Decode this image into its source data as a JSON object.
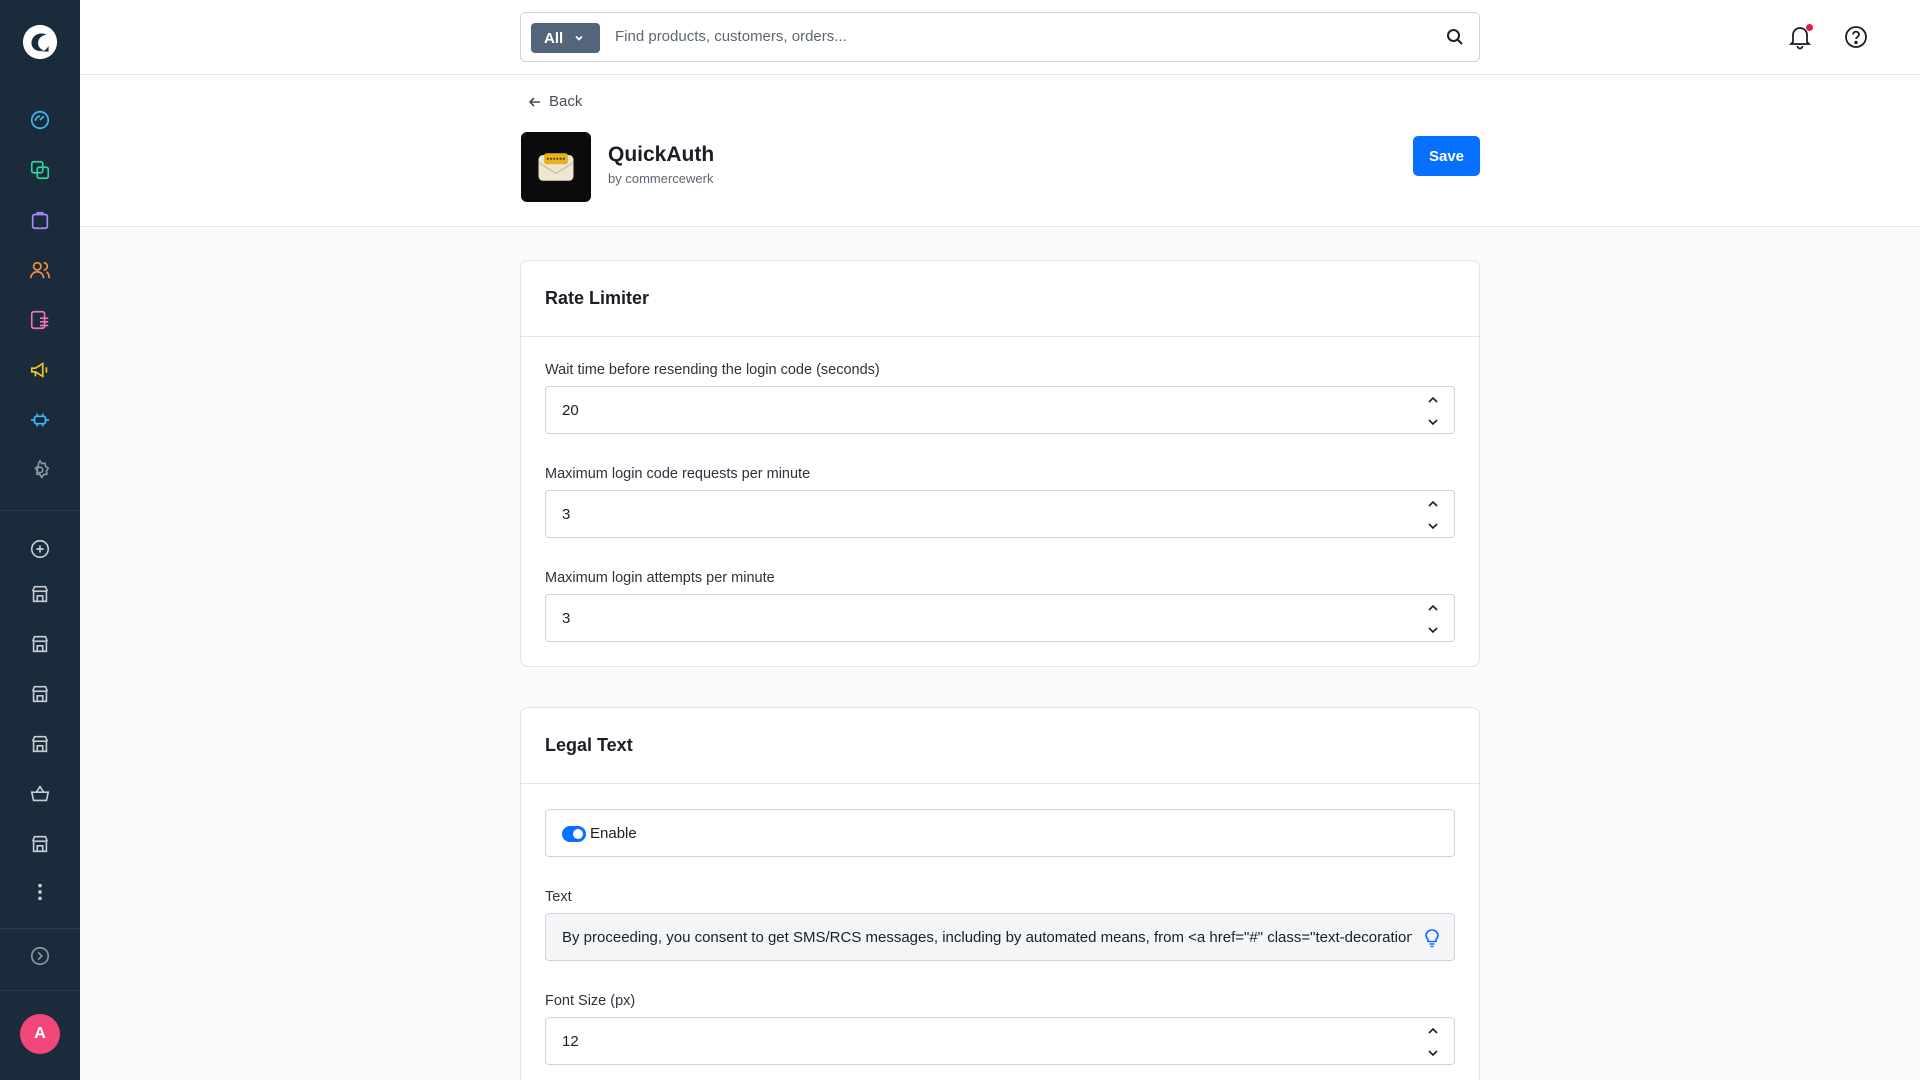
{
  "search": {
    "scope": "All",
    "placeholder": "Find products, customers, orders..."
  },
  "header": {
    "back_label": "Back",
    "app_name": "QuickAuth",
    "author": "by commercewerk",
    "save_label": "Save"
  },
  "rate_limiter": {
    "title": "Rate Limiter",
    "fields": [
      {
        "label": "Wait time before resending the login code (seconds)",
        "value": "20"
      },
      {
        "label": "Maximum login code requests per minute",
        "value": "3"
      },
      {
        "label": "Maximum login attempts per minute",
        "value": "3"
      }
    ]
  },
  "legal_text": {
    "title": "Legal Text",
    "enable_label": "Enable",
    "enabled": true,
    "text_label": "Text",
    "text_value": "By proceeding, you consent to get SMS/RCS messages, including by automated means, from <a href=\"#\" class=\"text-decoration",
    "font_size_label": "Font Size (px)",
    "font_size_value": "12"
  },
  "user": {
    "avatar_initial": "A"
  },
  "colors": {
    "sidebar_bg": "#1a2b3c",
    "primary": "#0870ff",
    "avatar": "#f0477a"
  }
}
